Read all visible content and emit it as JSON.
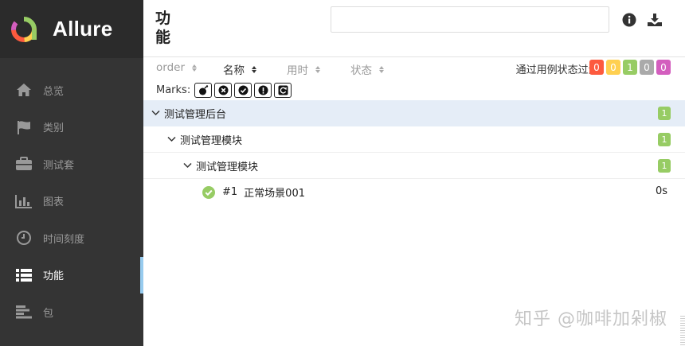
{
  "brand": {
    "name": "Allure"
  },
  "sidebar": {
    "items": [
      {
        "label": "总览",
        "icon": "home-icon"
      },
      {
        "label": "类别",
        "icon": "flag-icon"
      },
      {
        "label": "测试套",
        "icon": "briefcase-icon"
      },
      {
        "label": "图表",
        "icon": "bar-chart-icon"
      },
      {
        "label": "时间刻度",
        "icon": "clock-icon"
      },
      {
        "label": "功能",
        "icon": "list-icon",
        "active": true
      },
      {
        "label": "包",
        "icon": "align-left-icon"
      }
    ]
  },
  "header": {
    "title": "功能",
    "search_value": "",
    "info_icon": "info-icon",
    "download_icon": "download-icon"
  },
  "sort": {
    "columns": [
      {
        "label": "order",
        "active": false
      },
      {
        "label": "名称",
        "active": true
      },
      {
        "label": "用时",
        "active": false
      },
      {
        "label": "状态",
        "active": false
      }
    ]
  },
  "filter": {
    "label": "通过用例状态过滤:",
    "counters": [
      {
        "value": "0",
        "status": "failed",
        "color": "#fd5a3e"
      },
      {
        "value": "0",
        "status": "broken",
        "color": "#ffd050"
      },
      {
        "value": "1",
        "status": "passed",
        "color": "#97cc64"
      },
      {
        "value": "0",
        "status": "skipped",
        "color": "#aaaaaa"
      },
      {
        "value": "0",
        "status": "unknown",
        "color": "#d35ebe"
      }
    ]
  },
  "marks": {
    "label": "Marks:",
    "buttons": [
      "bomb-icon",
      "times-circle-icon",
      "check-circle-icon",
      "exclamation-circle-icon",
      "refresh-icon"
    ]
  },
  "tree": {
    "level1": {
      "label": "测试管理后台",
      "count": "1"
    },
    "level2": {
      "label": "测试管理模块",
      "count": "1"
    },
    "level3": {
      "label": "测试管理模块",
      "count": "1"
    },
    "case": {
      "number": "#1",
      "name": "正常场景001",
      "duration": "0s",
      "status": "passed"
    }
  },
  "watermark": "知乎 @咖啡加剁椒",
  "colors": {
    "sidebar_bg": "#343434",
    "brand_bg": "#2b2b2b",
    "active_indicator": "#97cbee",
    "selected_row": "#e5edf7",
    "passed": "#97cc64"
  }
}
